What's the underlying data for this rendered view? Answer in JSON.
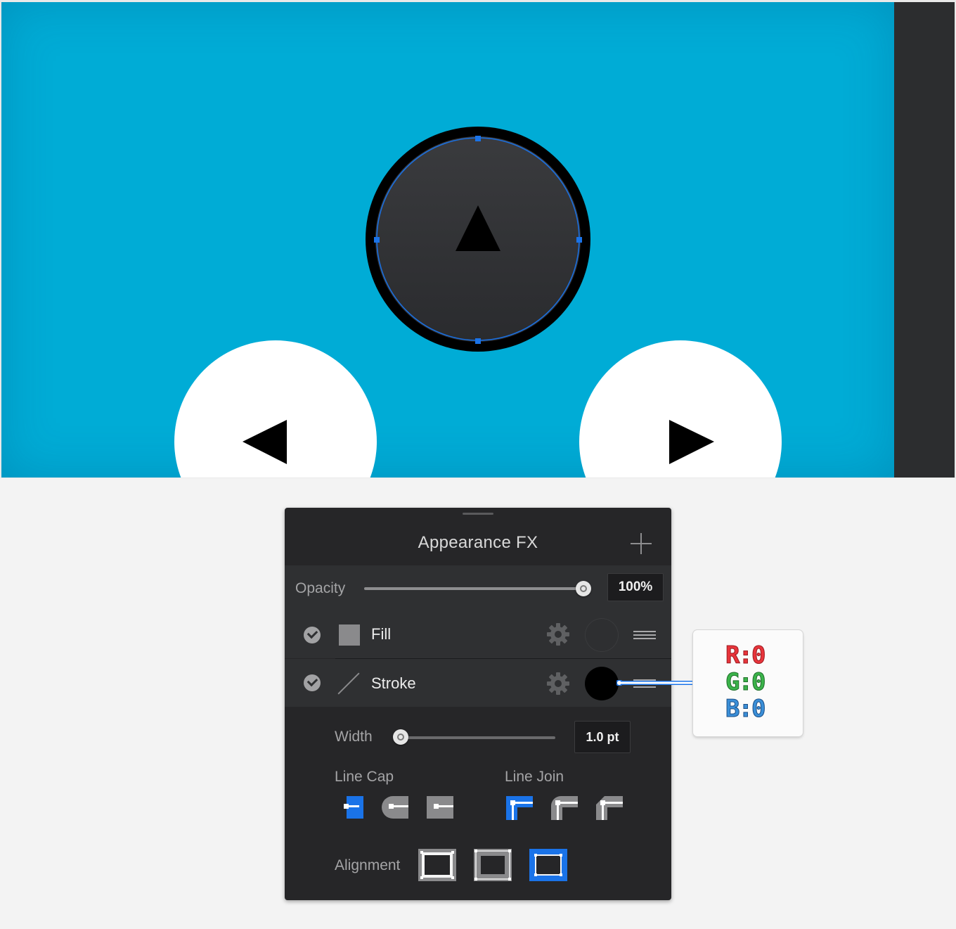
{
  "panel": {
    "title": "Appearance FX",
    "opacity": {
      "label": "Opacity",
      "value": "100%",
      "level": 1.0
    },
    "layers": [
      {
        "name": "Fill",
        "enabled": true,
        "color": "#2e2f31"
      },
      {
        "name": "Stroke",
        "enabled": true,
        "color": "#000000"
      }
    ],
    "width": {
      "label": "Width",
      "value": "1.0 pt",
      "level": 0.0
    },
    "line_cap": {
      "label": "Line Cap",
      "selected": 0
    },
    "line_join": {
      "label": "Line Join",
      "selected": 0
    },
    "alignment": {
      "label": "Alignment",
      "selected": 2
    }
  },
  "callout": {
    "r": "R:0",
    "g": "G:0",
    "b": "B:0"
  },
  "colors": {
    "artboard": "#00acd6",
    "accent": "#1a73e8",
    "panel_bg": "#262628",
    "row_bg": "#2f3032"
  },
  "icons": [
    "plus-icon",
    "check-icon",
    "gear-icon",
    "drag-handle-icon",
    "up-arrow-icon",
    "left-arrow-icon",
    "right-arrow-icon"
  ]
}
